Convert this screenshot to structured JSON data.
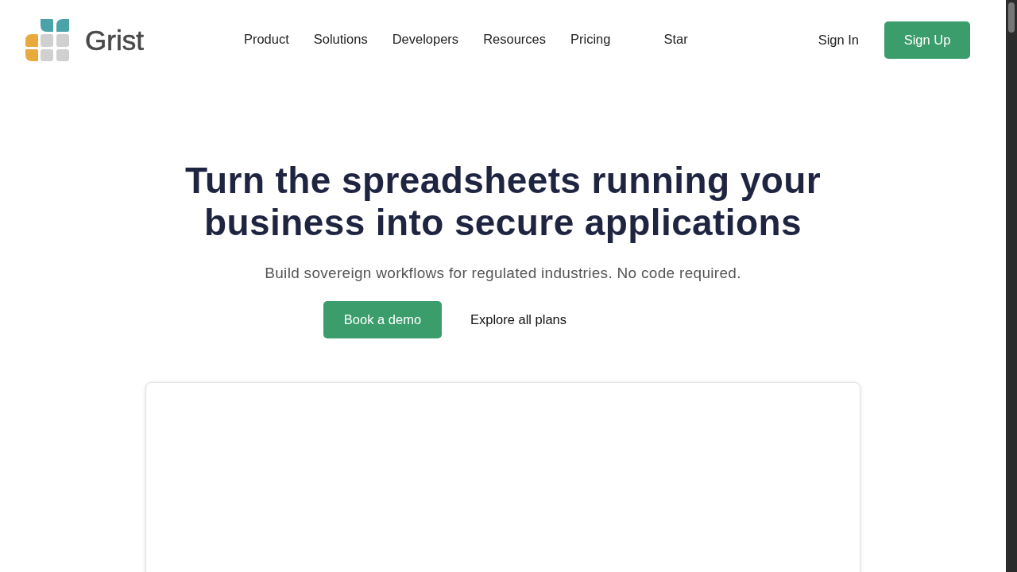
{
  "header": {
    "logo": {
      "text": "Grist"
    },
    "nav": [
      {
        "label": "Product",
        "kind": "menu"
      },
      {
        "label": "Solutions",
        "kind": "menu"
      },
      {
        "label": "Developers",
        "kind": "menu"
      },
      {
        "label": "Resources",
        "kind": "menu"
      },
      {
        "label": "Pricing",
        "kind": "menu"
      },
      {
        "label": "Star",
        "kind": "star"
      }
    ],
    "sign_in": "Sign In",
    "sign_up": "Sign Up"
  },
  "hero": {
    "title": "Turn the spreadsheets running your business into secure applications",
    "subtitle": "Build sovereign workflows for regulated industries. No code required.",
    "buttons": [
      {
        "label": "Book a demo",
        "kind": "primary"
      },
      {
        "label": "Explore all plans",
        "kind": "link"
      }
    ]
  }
}
